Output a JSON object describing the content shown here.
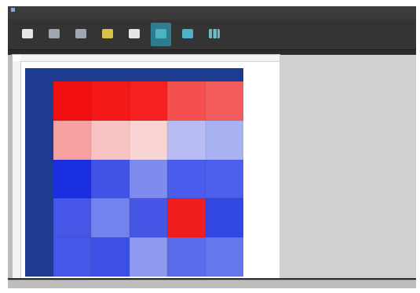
{
  "window": {
    "title": ""
  },
  "menubar": {
    "items": [
      "",
      "",
      "",
      ""
    ]
  },
  "toolbar": {
    "buttons": [
      {
        "name": "folder-icon",
        "label": ""
      },
      {
        "name": "profile-icon",
        "label": ""
      },
      {
        "name": "sequence-icon",
        "label": ""
      },
      {
        "name": "star-icon",
        "label": ""
      },
      {
        "name": "report-icon",
        "label": ""
      },
      {
        "name": "grid-view-icon",
        "label": ""
      },
      {
        "name": "heatmap-view-icon",
        "label": ""
      },
      {
        "name": "chart-icon",
        "label": ""
      }
    ],
    "active_index": 5
  },
  "heatmap": {
    "col_header": "",
    "row_header": "",
    "columns": [
      "",
      "",
      "",
      "",
      ""
    ],
    "rows": [
      "",
      "",
      "",
      "",
      ""
    ],
    "cells": [
      [
        {
          "color": "#f20f0f",
          "text": ""
        },
        {
          "color": "#f51818",
          "text": ""
        },
        {
          "color": "#f62020",
          "text": ""
        },
        {
          "color": "#f55050",
          "text": ""
        },
        {
          "color": "#f35d5d",
          "text": ""
        }
      ],
      [
        {
          "color": "#f6a0a0",
          "text": ""
        },
        {
          "color": "#f9c2c2",
          "text": ""
        },
        {
          "color": "#f8d4d4",
          "text": ""
        },
        {
          "color": "#b7bdf3",
          "text": ""
        },
        {
          "color": "#a8b1f1",
          "text": ""
        }
      ],
      [
        {
          "color": "#1a2fe2",
          "text": ""
        },
        {
          "color": "#4053e6",
          "text": ""
        },
        {
          "color": "#7f8cee",
          "text": ""
        },
        {
          "color": "#4a5ceb",
          "text": ""
        },
        {
          "color": "#4d60ec",
          "text": ""
        }
      ],
      [
        {
          "color": "#4656e6",
          "text": ""
        },
        {
          "color": "#7583ee",
          "text": ""
        },
        {
          "color": "#4556e6",
          "text": ""
        },
        {
          "color": "#ef1d1d",
          "text": ""
        },
        {
          "color": "#3347e3",
          "text": ""
        }
      ],
      [
        {
          "color": "#4457e7",
          "text": ""
        },
        {
          "color": "#3d50e6",
          "text": ""
        },
        {
          "color": "#8e99ef",
          "text": ""
        },
        {
          "color": "#5b6cea",
          "text": ""
        },
        {
          "color": "#6676ec",
          "text": ""
        }
      ]
    ]
  }
}
